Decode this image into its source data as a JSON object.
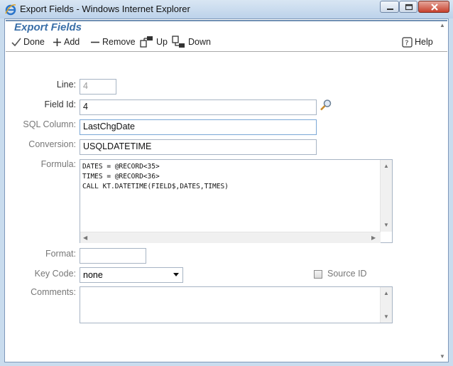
{
  "window": {
    "title": "Export Fields - Windows Internet Explorer"
  },
  "header": {
    "title": "Export Fields"
  },
  "toolbar": {
    "done": "Done",
    "add": "Add",
    "remove": "Remove",
    "up": "Up",
    "down": "Down",
    "help": "Help"
  },
  "form": {
    "line_label": "Line:",
    "line_value": "4",
    "field_id_label": "Field Id:",
    "field_id_value": "4",
    "sql_column_label": "SQL Column:",
    "sql_column_value": "LastChgDate",
    "conversion_label": "Conversion:",
    "conversion_value": "USQLDATETIME",
    "formula_label": "Formula:",
    "formula_value": "DATES = @RECORD<35>\nTIMES = @RECORD<36>\nCALL KT.DATETIME(FIELD$,DATES,TIMES)",
    "format_label": "Format:",
    "format_value": "",
    "key_code_label": "Key Code:",
    "key_code_value": "none",
    "source_id_label": "Source ID",
    "source_id_checked": false,
    "comments_label": "Comments:",
    "comments_value": ""
  }
}
